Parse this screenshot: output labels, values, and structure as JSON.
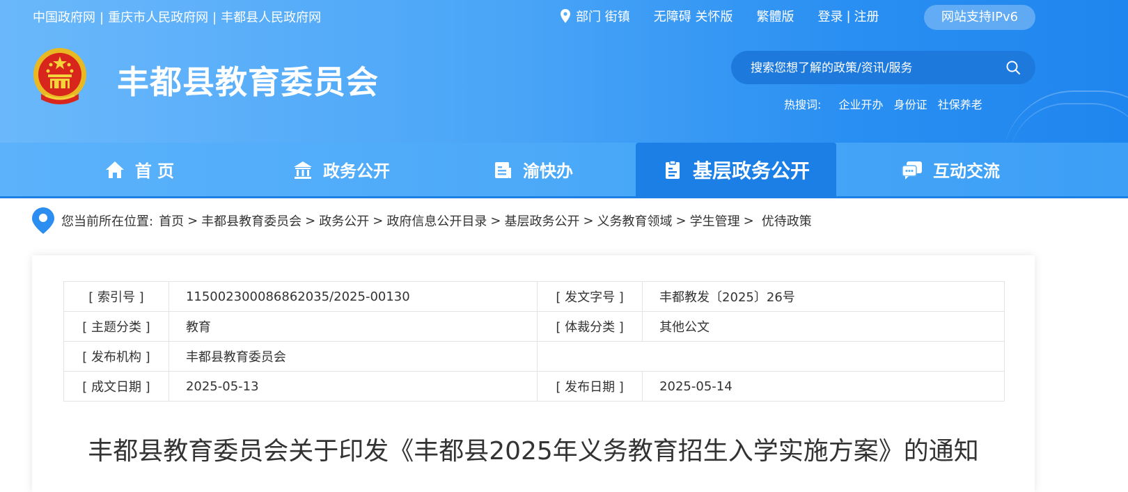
{
  "top_links": [
    "中国政府网",
    "重庆市人民政府网",
    "丰都县人民政府网"
  ],
  "top_links_sep": "|",
  "top_right": {
    "dept_street": "部门 街镇",
    "accessibility": "无障碍 关怀版",
    "traditional": "繁體版",
    "login": "登录",
    "login_sep": "|",
    "register": "注册",
    "ipv6": "网站支持IPv6"
  },
  "site_title": "丰都县教育委员会",
  "search": {
    "placeholder": "搜索您想了解的政策/资讯/服务"
  },
  "hot": {
    "label": "热搜词:",
    "words": [
      "企业开办",
      "身份证",
      "社保养老"
    ]
  },
  "nav": [
    {
      "label": "首 页",
      "icon": "home-icon"
    },
    {
      "label": "政务公开",
      "icon": "government-building-icon"
    },
    {
      "label": "渝快办",
      "icon": "service-card-icon"
    },
    {
      "label": "基层政务公开",
      "icon": "document-icon",
      "active": true
    },
    {
      "label": "互动交流",
      "icon": "chat-icon"
    }
  ],
  "breadcrumb": {
    "label": "您当前所在位置:",
    "items": [
      "首页",
      "丰都县教育委员会",
      "政务公开",
      "政府信息公开目录",
      "基层政务公开",
      "义务教育领域",
      "学生管理",
      "优待政策"
    ]
  },
  "meta": {
    "index_label": "[ 索引号 ]",
    "index_value": "11500230008686203​5/2025-00130",
    "doc_no_label": "[ 发文字号 ]",
    "doc_no_value": "丰都教发〔2025〕26号",
    "topic_label": "[ 主题分类 ]",
    "topic_value": "教育",
    "genre_label": "[ 体裁分类 ]",
    "genre_value": "其他公文",
    "org_label": "[ 发布机构 ]",
    "org_value": "丰都县教育委员会",
    "created_label": "[ 成文日期 ]",
    "created_value": "2025-05-13",
    "published_label": "[ 发布日期 ]",
    "published_value": "2025-05-14"
  },
  "document_title": "丰都县教育委员会关于印发《丰都县2025年义务教育招生入学实施方案》的通知",
  "colors": {
    "header": "#4aa5f7",
    "nav_active": "#1b7fe6",
    "search_bg": "#1d79dc",
    "accent_pin": "#2b8ef0"
  }
}
